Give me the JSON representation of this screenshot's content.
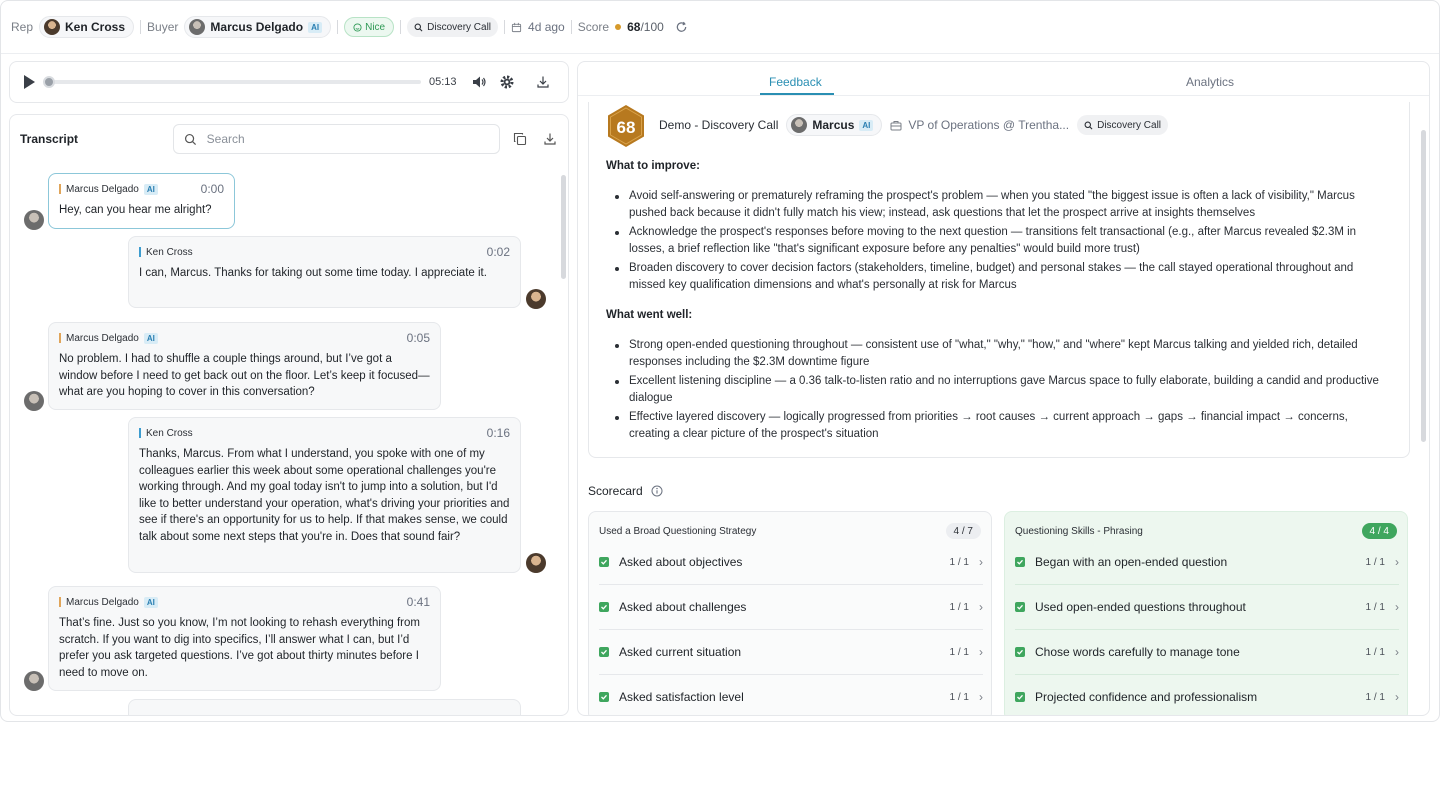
{
  "header": {
    "rep_label": "Rep",
    "rep_name": "Ken Cross",
    "buyer_label": "Buyer",
    "buyer_name": "Marcus Delgado",
    "ai_badge": "AI",
    "rating": "Nice",
    "call_type": "Discovery Call",
    "time_ago": "4d ago",
    "score_label": "Score",
    "score_value": "68",
    "score_max": "/100"
  },
  "player": {
    "duration": "05:13"
  },
  "transcript": {
    "title": "Transcript",
    "search_placeholder": "Search",
    "messages": [
      {
        "speaker": "Marcus Delgado",
        "ai": "AI",
        "time": "0:00",
        "text": "Hey, can you hear me alright?"
      },
      {
        "speaker": "Ken Cross",
        "time": "0:02",
        "text": "I can, Marcus. Thanks for taking out some time today. I appreciate it."
      },
      {
        "speaker": "Marcus Delgado",
        "ai": "AI",
        "time": "0:05",
        "text": "No problem. I had to shuffle a couple things around, but I’ve got a window before I need to get back out on the floor. Let’s keep it focused—what are you hoping to cover in this conversation?"
      },
      {
        "speaker": "Ken Cross",
        "time": "0:16",
        "text": "Thanks, Marcus. From what I understand, you spoke with one of my colleagues earlier this week about some operational challenges you're working through. And my goal today isn't to jump into a solution, but I'd like to better understand your operation, what's driving your priorities and see if there's an opportunity for us to help. If that makes sense, we could talk about some next steps that you're in. Does that sound fair?"
      },
      {
        "speaker": "Marcus Delgado",
        "ai": "AI",
        "time": "0:41",
        "text": "That’s fine. Just so you know, I’m not looking to rehash everything from scratch. If you want to dig into specifics, I’ll answer what I can, but I’d prefer you ask targeted questions. I’ve got about thirty minutes before I need to move on."
      }
    ]
  },
  "tabs": {
    "feedback": "Feedback",
    "analytics": "Analytics"
  },
  "feedback": {
    "score": "68",
    "call_title": "Demo - Discovery Call",
    "buyer_short": "Marcus",
    "ai_badge": "AI",
    "buyer_role": "VP of Operations @ Trentha...",
    "call_type": "Discovery Call",
    "improve_title": "What to improve:",
    "improve": [
      "Avoid self-answering or prematurely reframing the prospect's problem — when you stated \"the biggest issue is often a lack of visibility,\" Marcus pushed back because it didn't fully match his view; instead, ask questions that let the prospect arrive at insights themselves",
      "Acknowledge the prospect's responses before moving to the next question — transitions felt transactional (e.g., after Marcus revealed $2.3M in losses, a brief reflection like \"that's significant exposure before any penalties\" would build more trust)",
      "Broaden discovery to cover decision factors (stakeholders, timeline, budget) and personal stakes — the call stayed operational throughout and missed key qualification dimensions and what's personally at risk for Marcus"
    ],
    "well_title": "What went well:",
    "well": [
      "Strong open-ended questioning throughout — consistent use of \"what,\" \"why,\" \"how,\" and \"where\" kept Marcus talking and yielded rich, detailed responses including the $2.3M downtime figure",
      "Excellent listening discipline — a 0.36 talk-to-listen ratio and no interruptions gave Marcus space to fully elaborate, building a candid and productive dialogue",
      "Effective layered discovery — logically progressed from priorities → root causes → current approach → gaps → financial impact → concerns, creating a clear picture of the prospect's situation"
    ]
  },
  "scorecard": {
    "title": "Scorecard",
    "cards": [
      {
        "title": "Used a Broad Questioning Strategy",
        "badge": "4 / 7",
        "items": [
          {
            "label": "Asked about objectives",
            "score": "1 / 1"
          },
          {
            "label": "Asked about challenges",
            "score": "1 / 1"
          },
          {
            "label": "Asked current situation",
            "score": "1 / 1"
          },
          {
            "label": "Asked satisfaction level",
            "score": "1 / 1"
          }
        ]
      },
      {
        "title": "Questioning Skills - Phrasing",
        "badge": "4 / 4",
        "items": [
          {
            "label": "Began with an open-ended question",
            "score": "1 / 1"
          },
          {
            "label": "Used open-ended questions throughout",
            "score": "1 / 1"
          },
          {
            "label": "Chose words carefully to manage tone",
            "score": "1 / 1"
          },
          {
            "label": "Projected confidence and professionalism",
            "score": "1 / 1"
          }
        ]
      }
    ]
  },
  "colors": {
    "accent": "#2a8fb3",
    "success": "#3fa65e",
    "score_hex": "#b7791f"
  }
}
